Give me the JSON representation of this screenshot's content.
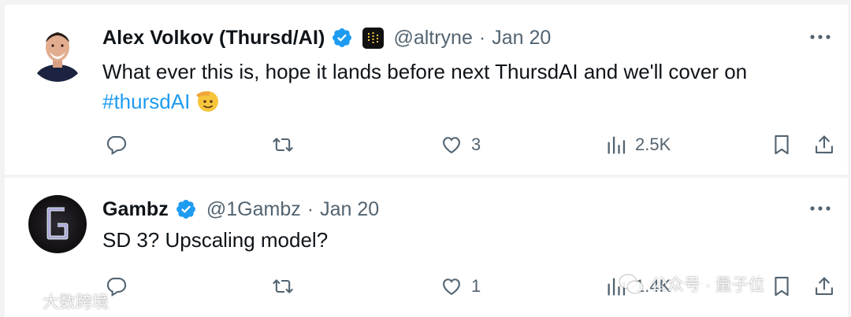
{
  "tweets": [
    {
      "author": "Alex Volkov (Thursd/AI)",
      "handle": "@altryne",
      "separator": "·",
      "date": "Jan 20",
      "text_main": "What ever this is, hope it lands before next ThursdAI and we'll cover on",
      "hashtag": "#thursdAI",
      "emoji_icon": "saluting-face-emoji",
      "replies": "",
      "reposts": "",
      "likes": "3",
      "views": "2.5K"
    },
    {
      "author": "Gambz",
      "handle": "@1Gambz",
      "separator": "·",
      "date": "Jan 20",
      "text_main": "SD 3? Upscaling model?",
      "replies": "",
      "reposts": "",
      "likes": "1",
      "views": "1.4K"
    }
  ],
  "watermarks": {
    "left": "大数跨境",
    "right": "公众号 · 量子位"
  },
  "colors": {
    "verified": "#1d9bf0",
    "link": "#1d9bf0",
    "text": "#0f1419",
    "muted": "#536471"
  }
}
